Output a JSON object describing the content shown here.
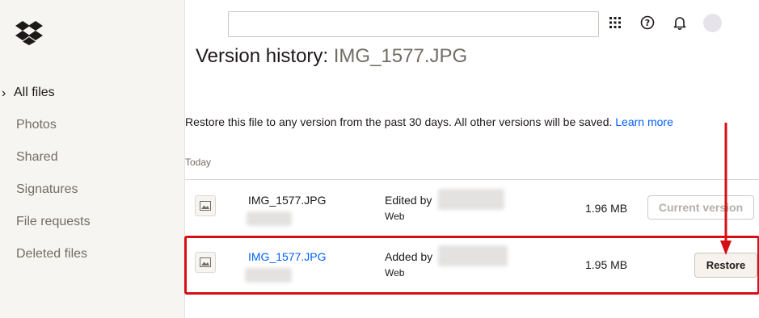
{
  "sidebar": {
    "logo_icon": "dropbox-logo-icon",
    "items": [
      {
        "label": "All files",
        "active": true
      },
      {
        "label": "Photos"
      },
      {
        "label": "Shared"
      },
      {
        "label": "Signatures"
      },
      {
        "label": "File requests"
      },
      {
        "label": "Deleted files"
      }
    ]
  },
  "header": {
    "search_placeholder": "",
    "icons": [
      "apps-grid-icon",
      "help-icon",
      "bell-icon",
      "avatar"
    ]
  },
  "page": {
    "title_prefix": "Version history:",
    "file_name": "IMG_1577.JPG",
    "description": "Restore this file to any version from the past 30 days. All other versions will be saved.",
    "learn_more": "Learn more",
    "section_label": "Today"
  },
  "versions": [
    {
      "file_name": "IMG_1577.JPG",
      "action": "Edited by",
      "via": "Web",
      "size": "1.96 MB",
      "button": "Current version"
    },
    {
      "file_name": "IMG_1577.JPG",
      "action": "Added by",
      "via": "Web",
      "size": "1.95 MB",
      "button": "Restore"
    }
  ],
  "annotation": {
    "color": "#d60f14"
  }
}
